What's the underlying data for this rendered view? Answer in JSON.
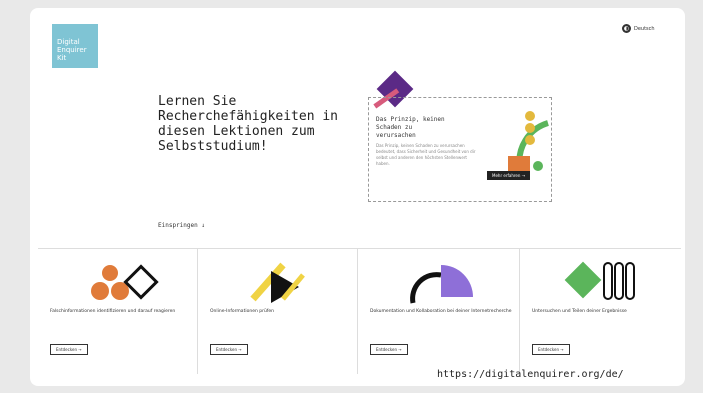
{
  "brand": {
    "logo_text": "Digital Enquirer Kit"
  },
  "header": {
    "language_icon": "language-icon",
    "language_label": "Deutsch"
  },
  "hero": {
    "title": "Lernen Sie Recherchefähigkeiten in diesen Lektionen zum Selbststudium!"
  },
  "feature": {
    "title": "Das Prinzip, keinen Schaden zu verursachen",
    "text": "Das Prinzip, keinen Schaden zu verursachen bedeutet, dass Sicherheit und Gesundheit von dir selbst und anderen den höchsten Stellenwert haben.",
    "button": "Mehr erfahren →"
  },
  "jump_link": "Einspringen ↓",
  "cards": [
    {
      "label": "Falschinformationen identifizieren und darauf reagieren",
      "button": "Entdecken →"
    },
    {
      "label": "Online-Informationen prüfen",
      "button": "Entdecken →"
    },
    {
      "label": "Dokumentation und Kollaboration bei deiner Internetrecherche",
      "button": "Entdecken →"
    },
    {
      "label": "Untersuchen und Teilen deiner Ergebnisse",
      "button": "Entdecken →"
    }
  ],
  "caption": "https://digitalenquirer.org/de/"
}
